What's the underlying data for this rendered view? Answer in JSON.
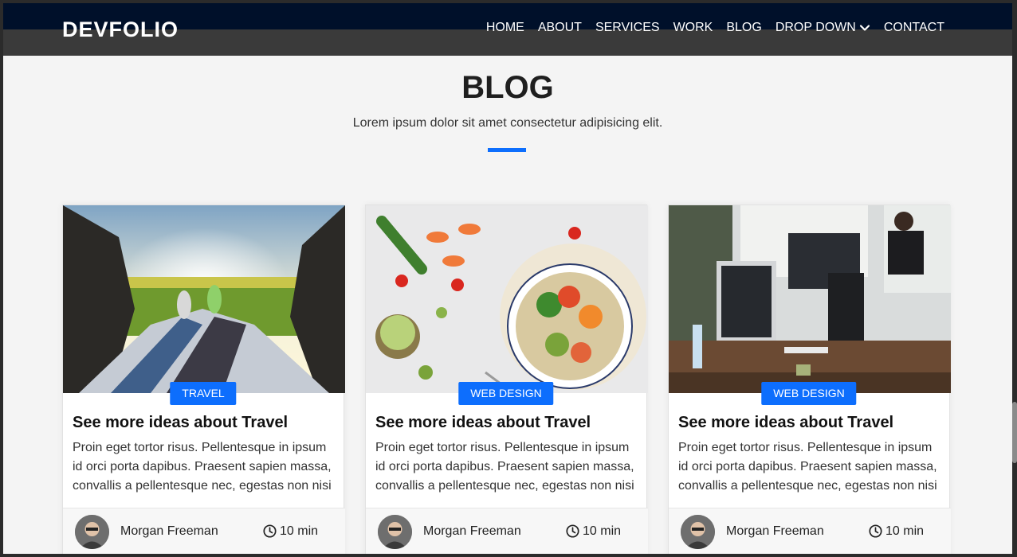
{
  "nav": {
    "brand": "DEVFOLIO",
    "items": [
      {
        "label": "HOME"
      },
      {
        "label": "ABOUT"
      },
      {
        "label": "SERVICES"
      },
      {
        "label": "WORK"
      },
      {
        "label": "BLOG"
      },
      {
        "label": "DROP DOWN",
        "icon": "chevron-down-icon"
      },
      {
        "label": "CONTACT"
      }
    ]
  },
  "section": {
    "title": "BLOG",
    "subtitle": "Lorem ipsum dolor sit amet consectetur adipisicing elit."
  },
  "cards": [
    {
      "image": "travel-photo",
      "category": "TRAVEL",
      "title": "See more ideas about Travel",
      "text": "Proin eget tortor risus. Pellentesque in ipsum id orci porta dapibus. Praesent sapien massa, convallis a pellentesque nec, egestas non nisi",
      "author": "Morgan Freeman",
      "read_time": "10 min"
    },
    {
      "image": "food-photo",
      "category": "WEB DESIGN",
      "title": "See more ideas about Travel",
      "text": "Proin eget tortor risus. Pellentesque in ipsum id orci porta dapibus. Praesent sapien massa, convallis a pellentesque nec, egestas non nisi",
      "author": "Morgan Freeman",
      "read_time": "10 min"
    },
    {
      "image": "office-photo",
      "category": "WEB DESIGN",
      "title": "See more ideas about Travel",
      "text": "Proin eget tortor risus. Pellentesque in ipsum id orci porta dapibus. Praesent sapien massa, convallis a pellentesque nec, egestas non nisi",
      "author": "Morgan Freeman",
      "read_time": "10 min"
    }
  ],
  "colors": {
    "accent": "#0d6efd",
    "nav_bg": "#00102a",
    "page_bg": "#f4f4f4"
  }
}
